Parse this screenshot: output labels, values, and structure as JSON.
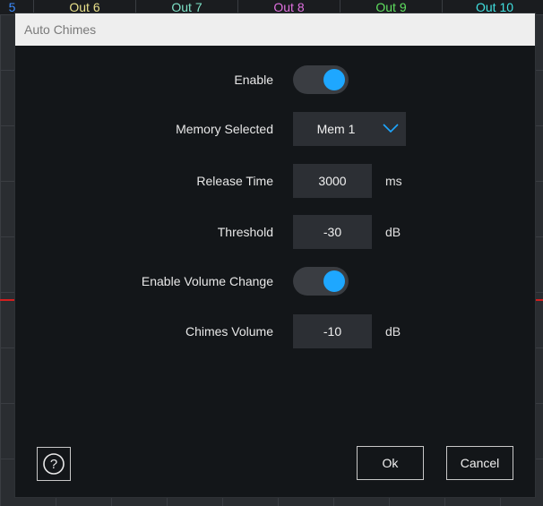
{
  "background": {
    "tabs": [
      {
        "label": "5",
        "color": "#3c8cff"
      },
      {
        "label": "Out 6",
        "color": "#e8e08a"
      },
      {
        "label": "Out 7",
        "color": "#7fe3c8"
      },
      {
        "label": "Out 8",
        "color": "#e070e0"
      },
      {
        "label": "Out 9",
        "color": "#5fe05f"
      },
      {
        "label": "Out 10",
        "color": "#40e0e0"
      }
    ]
  },
  "dialog": {
    "title": "Auto Chimes",
    "enable": {
      "label": "Enable",
      "on": true
    },
    "memory": {
      "label": "Memory Selected",
      "value": "Mem 1"
    },
    "release": {
      "label": "Release Time",
      "value": "3000",
      "unit": "ms"
    },
    "threshold": {
      "label": "Threshold",
      "value": "-30",
      "unit": "dB"
    },
    "volume_change": {
      "label": "Enable Volume Change",
      "on": true
    },
    "chimes_volume": {
      "label": "Chimes Volume",
      "value": "-10",
      "unit": "dB"
    },
    "help_symbol": "?",
    "ok_label": "Ok",
    "cancel_label": "Cancel"
  },
  "colors": {
    "accent": "#1ea7ff",
    "alarm_line": "#d21f1f"
  }
}
